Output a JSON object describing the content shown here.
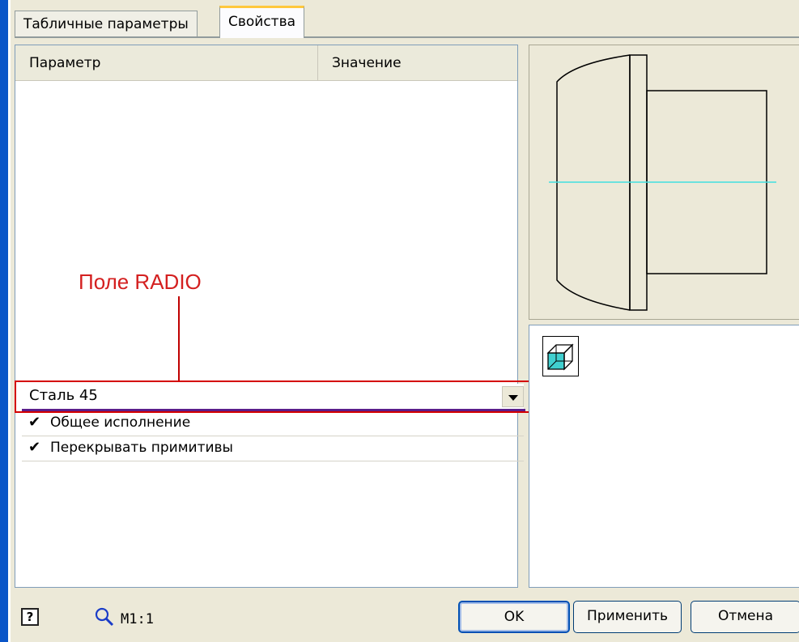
{
  "tabs": [
    {
      "label": "Табличные параметры"
    },
    {
      "label": "Свойства"
    }
  ],
  "columns": {
    "parameter": "Параметр",
    "value": "Значение"
  },
  "annotation": {
    "label": "Поле RADIO"
  },
  "combo": {
    "value": "Сталь 45"
  },
  "checkboxes": [
    {
      "label": "Общее исполнение",
      "checked": true
    },
    {
      "label": "Перекрывать примитивы",
      "checked": true
    }
  ],
  "icons": {
    "help": "help-icon",
    "zoom": "magnifier-icon",
    "view": "cube-view-icon",
    "dropdown": "chevron-down-icon",
    "check": "checkmark-icon"
  },
  "status": {
    "scale": "М1:1",
    "help_glyph": "?"
  },
  "buttons": {
    "ok": "OK",
    "apply": "Применить",
    "cancel": "Отмена"
  },
  "colors": {
    "annotation": "#d42020",
    "axis_line": "#40e0e0",
    "cube_face": "#40d0d0",
    "focus_underline": "#5a1e8c"
  }
}
